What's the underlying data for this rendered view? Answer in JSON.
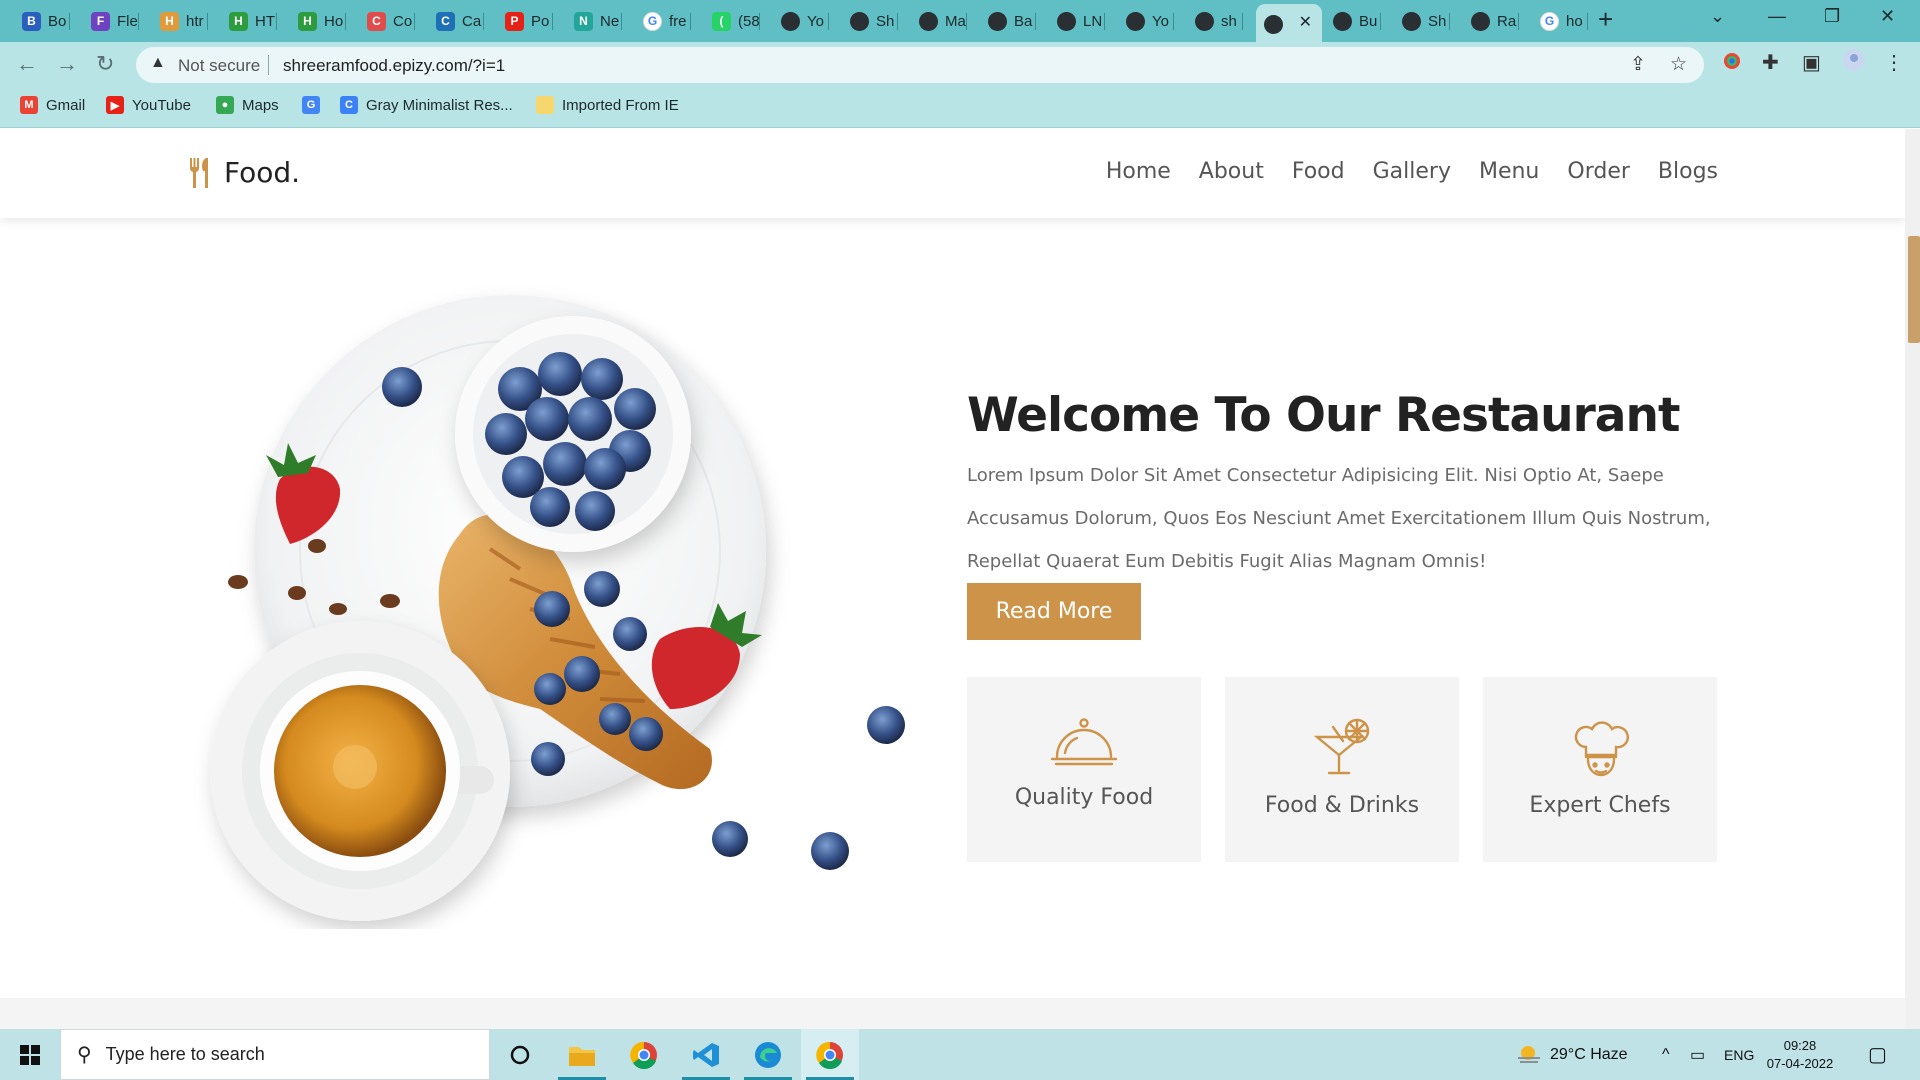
{
  "browser": {
    "tabs": [
      {
        "label": "Bo",
        "icon": "zoho-icon",
        "color": "#2b5fbd"
      },
      {
        "label": "Fle",
        "icon": "bootstrap-icon",
        "color": "#6f42c1"
      },
      {
        "label": "htr",
        "icon": "pencil-icon",
        "color": "#e09a3c"
      },
      {
        "label": "HT",
        "icon": "w3schools-icon",
        "color": "#2d9c3f"
      },
      {
        "label": "Ho",
        "icon": "w3schools-icon",
        "color": "#2d9c3f"
      },
      {
        "label": "Co",
        "icon": "rainbow-icon",
        "color": "#e04b4b"
      },
      {
        "label": "Ca",
        "icon": "monitor-icon",
        "color": "#1e6fb5"
      },
      {
        "label": "Po",
        "icon": "youtube-icon",
        "color": "#e62117"
      },
      {
        "label": "Ne",
        "icon": "diamond-icon",
        "color": "#23a69a"
      },
      {
        "label": "fre",
        "icon": "google-icon",
        "color": "#4285f4"
      },
      {
        "label": "(58",
        "icon": "whatsapp-icon",
        "color": "#25d366"
      },
      {
        "label": "Yo",
        "icon": "globe-icon",
        "color": "#2a2f33"
      },
      {
        "label": "Sh",
        "icon": "globe-icon",
        "color": "#2a2f33"
      },
      {
        "label": "Ma",
        "icon": "globe-icon",
        "color": "#2a2f33"
      },
      {
        "label": "Ba",
        "icon": "globe-icon",
        "color": "#2a2f33"
      },
      {
        "label": "LN",
        "icon": "globe-icon",
        "color": "#2a2f33"
      },
      {
        "label": "Yo",
        "icon": "globe-icon",
        "color": "#2a2f33"
      },
      {
        "label": "sh",
        "icon": "globe-icon",
        "color": "#2a2f33"
      },
      {
        "label": "",
        "icon": "globe-icon",
        "color": "#2a2f33",
        "active": true
      },
      {
        "label": "Bu",
        "icon": "globe-icon",
        "color": "#2a2f33"
      },
      {
        "label": "Sh",
        "icon": "globe-icon",
        "color": "#2a2f33"
      },
      {
        "label": "Ra",
        "icon": "globe-icon",
        "color": "#2a2f33"
      },
      {
        "label": "ho",
        "icon": "google-icon",
        "color": "#4285f4"
      }
    ],
    "security_label": "Not secure",
    "url": "shreeramfood.epizy.com/?i=1",
    "bookmarks": [
      {
        "label": "Gmail",
        "icon": "gmail-icon",
        "color": "#ea4335"
      },
      {
        "label": "YouTube",
        "icon": "youtube-icon",
        "color": "#e62117"
      },
      {
        "label": "Maps",
        "icon": "maps-icon",
        "color": "#34a853"
      },
      {
        "label": "",
        "icon": "chrome-icon",
        "color": "#4285f4"
      },
      {
        "label": "Gray Minimalist Res...",
        "icon": "canva-icon",
        "color": "#3b82f6"
      },
      {
        "label": "Imported From IE",
        "icon": "folder-icon",
        "color": "#f5d76e"
      }
    ]
  },
  "site": {
    "logo_text": "Food.",
    "nav": [
      "Home",
      "About",
      "Food",
      "Gallery",
      "Menu",
      "Order",
      "Blogs"
    ],
    "welcome_title": "Welcome To Our Restaurant",
    "welcome_text": "Lorem Ipsum Dolor Sit Amet Consectetur Adipisicing Elit. Nisi Optio At, Saepe Accusamus Dolorum, Quos Eos Nesciunt Amet Exercitationem Illum Quis Nostrum, Repellat Quaerat Eum Debitis Fugit Alias Magnam Omnis!",
    "read_more": "Read More",
    "features": [
      {
        "label": "Quality Food",
        "icon": "cloche-icon"
      },
      {
        "label": "Food & Drinks",
        "icon": "cocktail-icon"
      },
      {
        "label": "Expert Chefs",
        "icon": "chef-hat-icon"
      }
    ],
    "accent_color": "#cd9449"
  },
  "taskbar": {
    "search_placeholder": "Type here to search",
    "weather": "29°C  Haze",
    "language": "ENG",
    "time": "09:28",
    "date": "07-04-2022"
  }
}
